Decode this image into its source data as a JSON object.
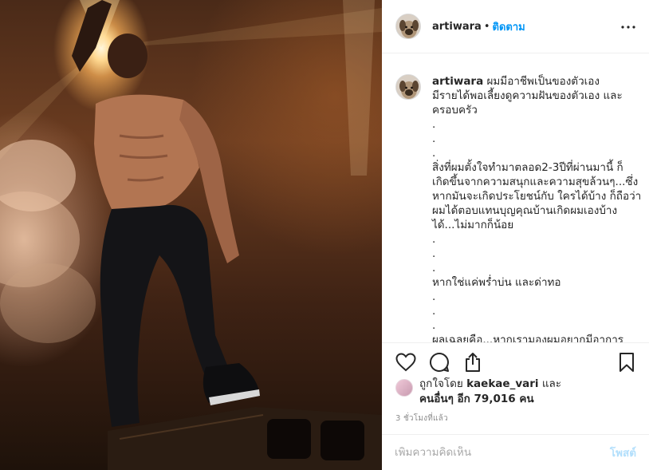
{
  "post": {
    "username": "artiwara",
    "separator": "•",
    "follow_label": "ติดตาม",
    "more_icon": "more-options-icon"
  },
  "caption": {
    "username": "artiwara",
    "lines": [
      "ผมมีอาชีพเป็นของตัวเอง",
      "มีรายได้พอเลี้ยงดูความฝันของตัวเอง และ",
      "ครอบครัว",
      ".",
      ".",
      ".",
      "สิ่งที่ผมตั้งใจทำมาตลอด2-3ปีที่ผ่านมานี้ ก็",
      "เกิดขึ้นจากความสนุกและความสุขล้วนๆ...ซึ่ง",
      "หากมันจะเกิดประโยชน์กับ ใครได้บ้าง ก็ถือว่า",
      "ผมได้ตอบแทนบุญคุณบ้านเกิดผมเองบ้าง",
      "ได้...ไม่มากก็น้อย",
      ".",
      ".",
      ".",
      "หากใช่แค่พร่ำบ่น และด่าทอ",
      ".",
      ".",
      ".",
      "ผลเฉลยคือ...หากเรามองผมอยากมีอาการ"
    ]
  },
  "actions": {
    "like_icon": "heart-icon",
    "comment_icon": "comment-icon",
    "share_icon": "share-icon",
    "save_icon": "bookmark-icon"
  },
  "likes": {
    "prefix": "ถูกใจโดย",
    "liker": "kaekae_vari",
    "and": "และ",
    "others_label": "คนอื่นๆ อีก 79,016 คน"
  },
  "timestamp": "3 ชั่วโมงที่แล้ว",
  "comment": {
    "placeholder": "เพิ่มความคิดเห็น",
    "post_label": "โพสต์"
  }
}
